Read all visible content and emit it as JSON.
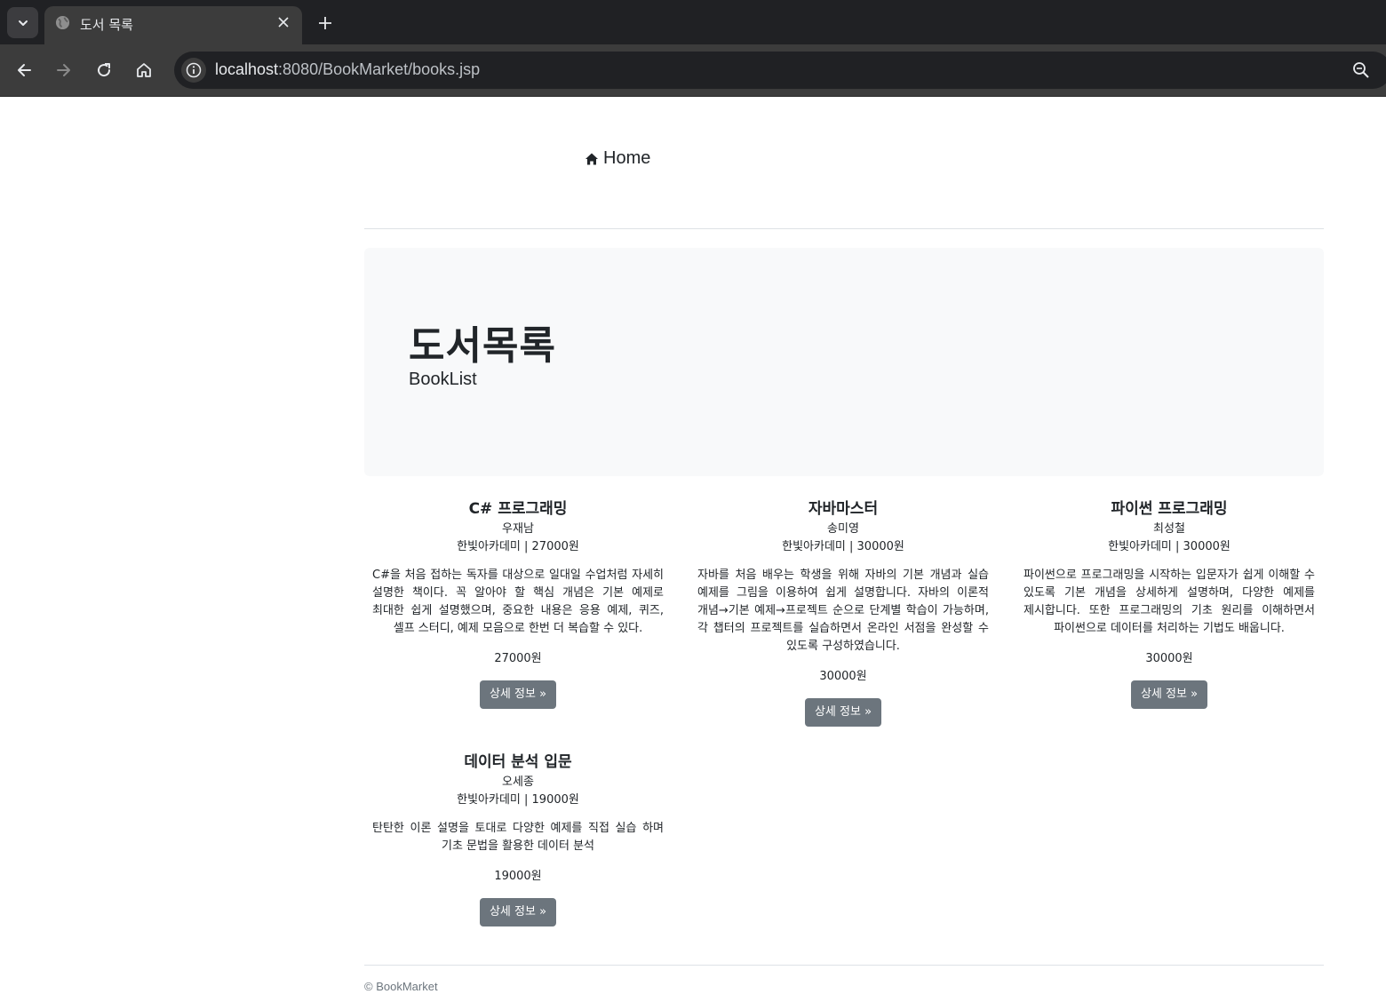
{
  "browser": {
    "tab_title": "도서 목록",
    "url_host": "localhost",
    "url_rest": ":8080/BookMarket/books.jsp"
  },
  "nav": {
    "home_label": "Home"
  },
  "jumbotron": {
    "title": "도서목록",
    "subtitle": "BookList"
  },
  "books": [
    {
      "title": "C# 프로그래밍",
      "author": "우재남",
      "publisher": "한빛아카데미 | 27000원",
      "description": "C#을 처음 접하는 독자를 대상으로 일대일 수업처럼 자세히 설명한 책이다. 꼭 알아야 할 핵심 개념은 기본 예제로 최대한 쉽게 설명했으며, 중요한 내용은 응용 예제, 퀴즈, 셀프 스터디, 예제 모음으로 한번 더 복습할 수 있다.",
      "price": "27000원",
      "button": "상세 정보 »"
    },
    {
      "title": "자바마스터",
      "author": "송미영",
      "publisher": "한빛아카데미 | 30000원",
      "description": "자바를 처음 배우는 학생을 위해 자바의 기본 개념과 실습 예제를 그림을 이용하여 쉽게 설명합니다. 자바의 이론적 개념→기본 예제→프로젝트 순으로 단계별 학습이 가능하며, 각 챕터의 프로젝트를 실습하면서 온라인 서점을 완성할 수 있도록 구성하였습니다.",
      "price": "30000원",
      "button": "상세 정보 »"
    },
    {
      "title": "파이썬 프로그래밍",
      "author": "최성철",
      "publisher": "한빛아카데미 | 30000원",
      "description": "파이썬으로 프로그래밍을 시작하는 입문자가 쉽게 이해할 수 있도록 기본 개념을 상세하게 설명하며, 다양한 예제를 제시합니다. 또한 프로그래밍의 기초 원리를 이해하면서 파이썬으로 데이터를 처리하는 기법도 배웁니다.",
      "price": "30000원",
      "button": "상세 정보 »"
    },
    {
      "title": "데이터 분석 입문",
      "author": "오세종",
      "publisher": "한빛아카데미 | 19000원",
      "description": "탄탄한 이론 설명을 토대로 다양한 예제를 직접 실습 하며 기초 문법을 활용한 데이터 분석",
      "price": "19000원",
      "button": "상세 정보 »"
    }
  ],
  "footer": {
    "text": "© BookMarket"
  }
}
